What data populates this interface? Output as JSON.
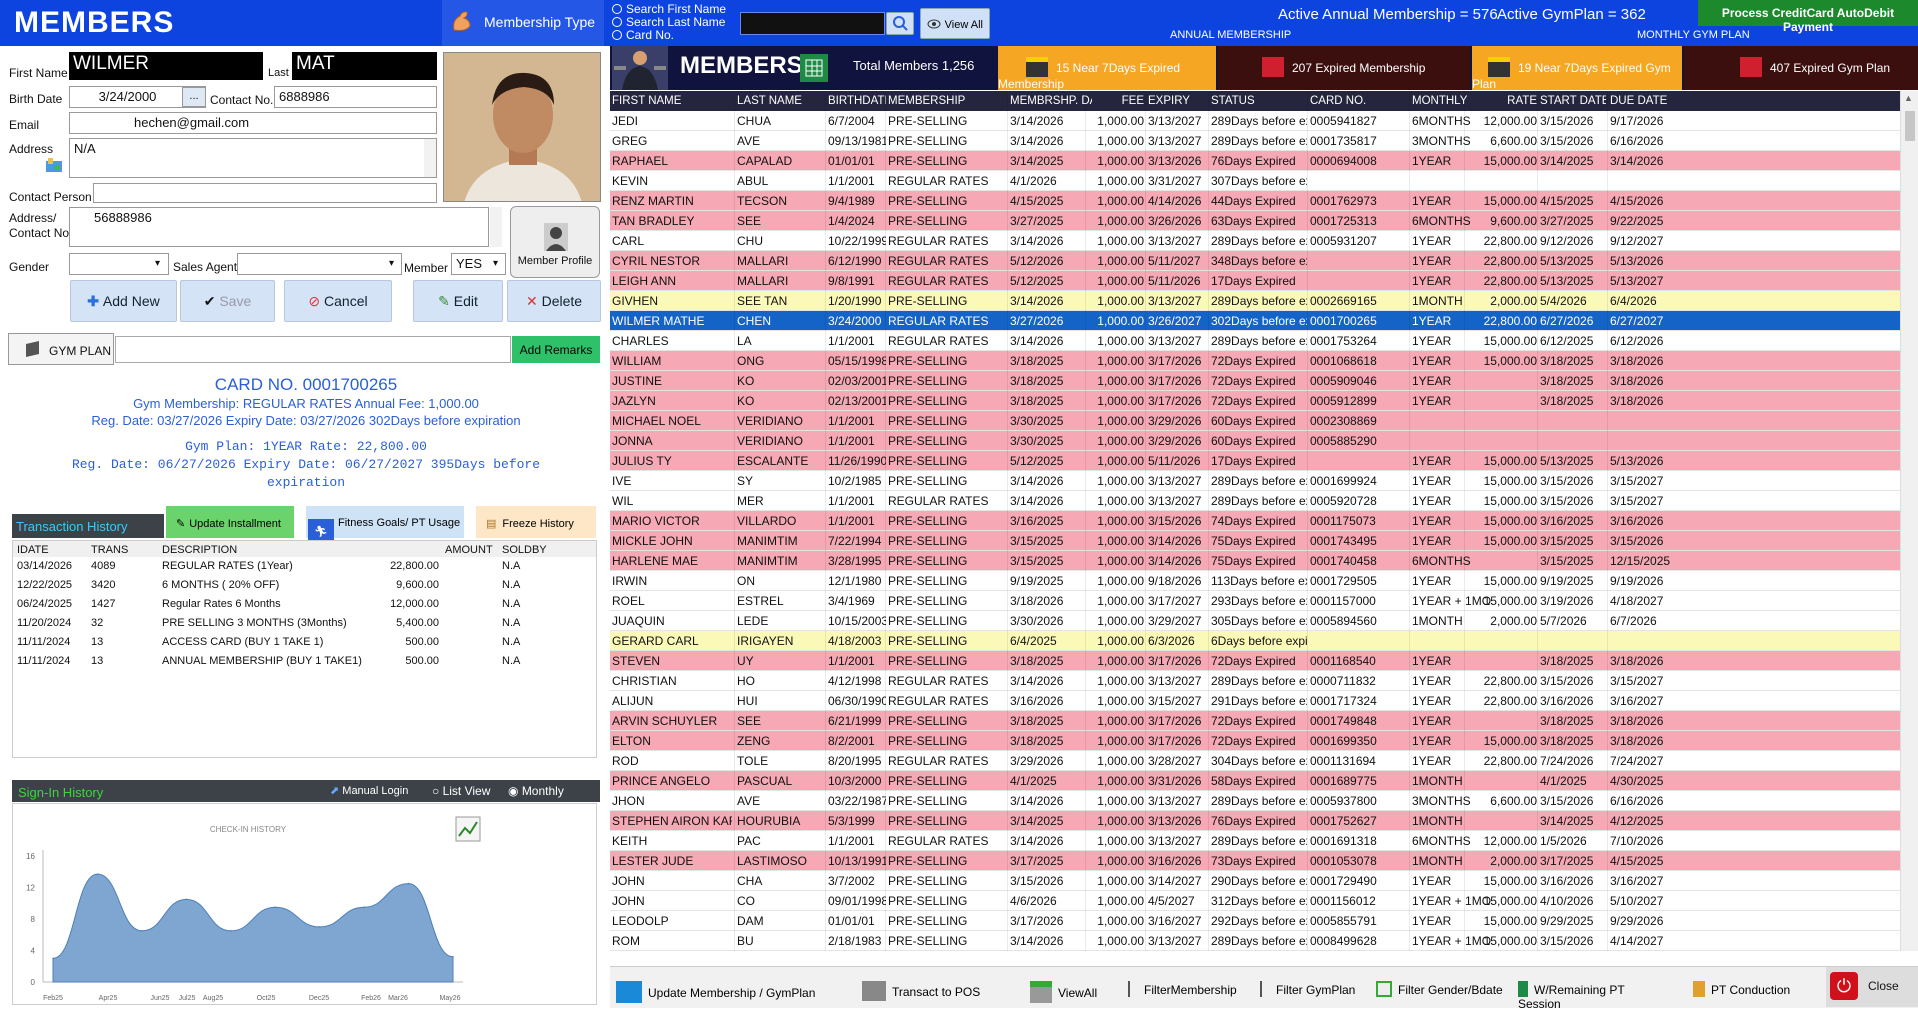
{
  "app": {
    "title": "MEMBERS"
  },
  "topbar": {
    "membership_type_label": "Membership Type",
    "search_options": [
      "Search First Name",
      "Search Last Name",
      "Card No."
    ],
    "search_value": "",
    "view_all_label": "View All",
    "annual_count": "Active Annual Membership = 576",
    "gym_count": "Active GymPlan = 362",
    "annual_label": "ANNUAL MEMBERSHIP",
    "monthly_label": "MONTHLY GYM PLAN",
    "cc_button": "Process CreditCard AutoDebit Payment"
  },
  "form": {
    "first_name_label": "First Name",
    "first_name": "WILMER",
    "last_label": "Last",
    "last_name": "MAT",
    "birth_label": "Birth Date",
    "birth_date": "3/24/2000",
    "date_btn": "...",
    "contact_label": "Contact No.",
    "contact": "6888986",
    "email_label": "Email",
    "email": "hechen@gmail.com",
    "address_label": "Address",
    "address": "N/A",
    "contact_person_label": "Contact Person",
    "contact_person": "",
    "address_contact_label1": "Address/",
    "address_contact_label2": "Contact No",
    "address_contact": "56888986",
    "gender_label": "Gender",
    "gender": "",
    "sales_agent_label": "Sales Agent",
    "sales_agent": "",
    "member_label": "Member",
    "member": "YES",
    "member_profile_label": "Member Profile"
  },
  "actions": {
    "add_new": "Add New",
    "save": "Save",
    "cancel": "Cancel",
    "edit": "Edit",
    "delete": "Delete"
  },
  "gymplan": {
    "tab": "GYM PLAN",
    "remarks": "",
    "add_remarks": "Add Remarks"
  },
  "card": {
    "card_no": "CARD NO.   0001700265",
    "line1": "Gym Membership: REGULAR RATES   Annual Fee: 1,000.00",
    "line2": "Reg. Date: 03/27/2026  Expiry Date: 03/27/2026   302Days before expiration",
    "line3": "Gym Plan: 1YEAR   Rate: 22,800.00",
    "line4": "Reg. Date: 06/27/2026  Expiry Date: 06/27/2027   395Days before",
    "line5": "expiration"
  },
  "transactions": {
    "title": "Transaction History",
    "update_installment": "Update Installment",
    "fitness_goals": "Fitness Goals/ PT Usage",
    "freeze_history": "Freeze History",
    "headers": [
      "IDATE",
      "TRANS",
      "DESCRIPTION",
      "AMOUNT",
      "SOLDBY"
    ],
    "rows": [
      [
        "03/14/2026",
        "4089",
        "REGULAR RATES (1Year)",
        "22,800.00",
        "N.A"
      ],
      [
        "12/22/2025",
        "3420",
        "6 MONTHS ( 20% OFF)",
        "9,600.00",
        "N.A"
      ],
      [
        "06/24/2025",
        "1427",
        "Regular Rates 6 Months",
        "12,000.00",
        "N.A"
      ],
      [
        "11/20/2024",
        "32",
        "PRE SELLING  3 MONTHS (3Months)",
        "5,400.00",
        "N.A"
      ],
      [
        "11/11/2024",
        "13",
        "ACCESS CARD (BUY 1 TAKE 1)",
        "500.00",
        "N.A"
      ],
      [
        "11/11/2024",
        "13",
        "ANNUAL MEMBERSHIP (BUY 1 TAKE1)",
        "500.00",
        "N.A"
      ]
    ]
  },
  "signin": {
    "title": "Sign-In History",
    "manual_login": "Manual Login",
    "list_view": "List View",
    "monthly": "Monthly",
    "chart_title": "CHECK-IN HISTORY"
  },
  "chart_data": {
    "type": "area",
    "title": "CHECK-IN HISTORY",
    "x": [
      "Feb25",
      "Apr25",
      "Jun25",
      "Jul25",
      "Aug25",
      "Oct25",
      "Dec25",
      "Feb26",
      "Mar26",
      "May26"
    ],
    "series": [
      {
        "values": [
          3,
          13.7,
          6.5,
          10.5,
          6.5,
          9.5,
          7,
          9.5,
          12.5,
          3.2
        ]
      }
    ],
    "yticks": [
      0,
      2,
      4,
      6,
      8,
      10,
      12,
      14,
      16
    ],
    "ylim": [
      0,
      16
    ],
    "yticks_shown": [
      "0",
      "2",
      "4",
      "6",
      "8",
      "10",
      "12",
      "14",
      "16"
    ],
    "color": "#7ea6d1"
  },
  "members_header": {
    "title": "MEMBERS",
    "total": "Total Members 1,256",
    "near_expired_membership": "15 Near 7Days Expired Membership",
    "expired_membership": "207 Expired Membership",
    "near_expired_gym": "19 Near 7Days Expired Gym Plan",
    "expired_gym": "407 Expired Gym Plan"
  },
  "grid": {
    "headers": [
      "FIRST NAME",
      "LAST NAME",
      "BIRTHDATE",
      "MEMBERSHIP",
      "MEMBRSHP. DATE",
      "FEE",
      "EXPIRY",
      "STATUS",
      "CARD NO.",
      "MONTHLY",
      "RATE",
      "START DATE",
      "DUE DATE"
    ],
    "rows": [
      {
        "c": [
          "JEDI",
          "CHUA",
          "6/7/2004",
          "PRE-SELLING",
          "3/14/2026",
          "1,000.00",
          "3/13/2027",
          "289Days before exp",
          "0005941827",
          "6MONTHS",
          "12,000.00",
          "3/15/2026",
          "9/17/2026"
        ],
        "s": ""
      },
      {
        "c": [
          "GREG",
          "AVE",
          "09/13/1981",
          "PRE-SELLING",
          "3/14/2026",
          "1,000.00",
          "3/13/2027",
          "289Days before exp",
          "0001735817",
          "3MONTHS",
          "6,600.00",
          "3/15/2026",
          "6/16/2026"
        ],
        "s": ""
      },
      {
        "c": [
          "RAPHAEL",
          "CAPALAD",
          "01/01/01",
          "PRE-SELLING",
          "3/14/2025",
          "1,000.00",
          "3/13/2026",
          "76Days Expired",
          "0000694008",
          "1YEAR",
          "15,000.00",
          "3/14/2025",
          "3/14/2026"
        ],
        "s": "pink"
      },
      {
        "c": [
          "KEVIN",
          "ABUL",
          "1/1/2001",
          "REGULAR RATES",
          "4/1/2026",
          "1,000.00",
          "3/31/2027",
          "307Days before exp",
          "",
          "",
          "",
          "",
          ""
        ],
        "s": ""
      },
      {
        "c": [
          "RENZ MARTIN",
          "TECSON",
          "9/4/1989",
          "PRE-SELLING",
          "4/15/2025",
          "1,000.00",
          "4/14/2026",
          "44Days Expired",
          "0001762973",
          "1YEAR",
          "15,000.00",
          "4/15/2025",
          "4/15/2026"
        ],
        "s": "pink"
      },
      {
        "c": [
          "TAN BRADLEY",
          "SEE",
          "1/4/2024",
          "PRE-SELLING",
          "3/27/2025",
          "1,000.00",
          "3/26/2026",
          "63Days Expired",
          "0001725313",
          "6MONTHS",
          "9,600.00",
          "3/27/2025",
          "9/22/2025"
        ],
        "s": "pink"
      },
      {
        "c": [
          "CARL",
          "CHU",
          "10/22/1999",
          "REGULAR RATES",
          "3/14/2026",
          "1,000.00",
          "3/13/2027",
          "289Days before exp",
          "0005931207",
          "1YEAR",
          "22,800.00",
          "9/12/2026",
          "9/12/2027"
        ],
        "s": ""
      },
      {
        "c": [
          "CYRIL NESTOR",
          "MALLARI",
          "6/12/1990",
          "REGULAR RATES",
          "5/12/2026",
          "1,000.00",
          "5/11/2027",
          "348Days before exp",
          "",
          "1YEAR",
          "22,800.00",
          "5/13/2025",
          "5/13/2026"
        ],
        "s": "pink"
      },
      {
        "c": [
          "LEIGH ANN",
          "MALLARI",
          "9/8/1991",
          "REGULAR RATES",
          "5/12/2025",
          "1,000.00",
          "5/11/2026",
          "17Days Expired",
          "",
          "1YEAR",
          "22,800.00",
          "5/13/2025",
          "5/13/2027"
        ],
        "s": "pink"
      },
      {
        "c": [
          "GIVHEN",
          "SEE TAN",
          "1/20/1990",
          "PRE-SELLING",
          "3/14/2026",
          "1,000.00",
          "3/13/2027",
          "289Days before exp",
          "0002669165",
          "1MONTH",
          "2,000.00",
          "5/4/2026",
          "6/4/2026"
        ],
        "s": "yellow"
      },
      {
        "c": [
          "WILMER MATHE",
          "CHEN",
          "3/24/2000",
          "REGULAR RATES",
          "3/27/2026",
          "1,000.00",
          "3/26/2027",
          "302Days before exp",
          "0001700265",
          "1YEAR",
          "22,800.00",
          "6/27/2026",
          "6/27/2027"
        ],
        "s": "sel"
      },
      {
        "c": [
          "CHARLES",
          "LA",
          "1/1/2001",
          "REGULAR RATES",
          "3/14/2026",
          "1,000.00",
          "3/13/2027",
          "289Days before exp",
          "0001753264",
          "1YEAR",
          "15,000.00",
          "6/12/2025",
          "6/12/2026"
        ],
        "s": ""
      },
      {
        "c": [
          "WILLIAM",
          "ONG",
          "05/15/1998",
          "PRE-SELLING",
          "3/18/2025",
          "1,000.00",
          "3/17/2026",
          "72Days Expired",
          "0001068618",
          "1YEAR",
          "15,000.00",
          "3/18/2025",
          "3/18/2026"
        ],
        "s": "pink"
      },
      {
        "c": [
          "JUSTINE",
          "KO",
          "02/03/2001",
          "PRE-SELLING",
          "3/18/2025",
          "1,000.00",
          "3/17/2026",
          "72Days Expired",
          "0005909046",
          "1YEAR",
          "",
          "3/18/2025",
          "3/18/2026"
        ],
        "s": "pink"
      },
      {
        "c": [
          "JAZLYN",
          "KO",
          "02/13/2001",
          "PRE-SELLING",
          "3/18/2025",
          "1,000.00",
          "3/17/2026",
          "72Days Expired",
          "0005912899",
          "1YEAR",
          "",
          "3/18/2025",
          "3/18/2026"
        ],
        "s": "pink"
      },
      {
        "c": [
          "MICHAEL NOEL",
          "VERIDIANO",
          "1/1/2001",
          "PRE-SELLING",
          "3/30/2025",
          "1,000.00",
          "3/29/2026",
          "60Days Expired",
          "0002308869",
          "",
          "",
          "",
          ""
        ],
        "s": "pink"
      },
      {
        "c": [
          "JONNA",
          "VERIDIANO",
          "1/1/2001",
          "PRE-SELLING",
          "3/30/2025",
          "1,000.00",
          "3/29/2026",
          "60Days Expired",
          "0005885290",
          "",
          "",
          "",
          ""
        ],
        "s": "pink"
      },
      {
        "c": [
          "JULIUS TY",
          "ESCALANTE",
          "11/26/1990",
          "PRE-SELLING",
          "5/12/2025",
          "1,000.00",
          "5/11/2026",
          "17Days Expired",
          "",
          "1YEAR",
          "15,000.00",
          "5/13/2025",
          "5/13/2026"
        ],
        "s": "pink"
      },
      {
        "c": [
          "IVE",
          "SY",
          "10/2/1985",
          "PRE-SELLING",
          "3/14/2026",
          "1,000.00",
          "3/13/2027",
          "289Days before exp",
          "0001699924",
          "1YEAR",
          "15,000.00",
          "3/15/2026",
          "3/15/2027"
        ],
        "s": ""
      },
      {
        "c": [
          "WIL",
          "MER",
          "1/1/2001",
          "REGULAR RATES",
          "3/14/2026",
          "1,000.00",
          "3/13/2027",
          "289Days before exp",
          "0005920728",
          "1YEAR",
          "15,000.00",
          "3/15/2026",
          "3/15/2027"
        ],
        "s": ""
      },
      {
        "c": [
          "MARIO VICTOR",
          "VILLARDO",
          "1/1/2001",
          "PRE-SELLING",
          "3/16/2025",
          "1,000.00",
          "3/15/2026",
          "74Days Expired",
          "0001175073",
          "1YEAR",
          "15,000.00",
          "3/16/2025",
          "3/16/2026"
        ],
        "s": "pink"
      },
      {
        "c": [
          "MICKLE JOHN",
          "MANIMTIM",
          "7/22/1994",
          "PRE-SELLING",
          "3/15/2025",
          "1,000.00",
          "3/14/2026",
          "75Days Expired",
          "0001743495",
          "1YEAR",
          "15,000.00",
          "3/15/2025",
          "3/15/2026"
        ],
        "s": "pink"
      },
      {
        "c": [
          "HARLENE MAE",
          "MANIMTIM",
          "3/28/1995",
          "PRE-SELLING",
          "3/15/2025",
          "1,000.00",
          "3/14/2026",
          "75Days Expired",
          "0001740458",
          "6MONTHS",
          "",
          "3/15/2025",
          "12/15/2025"
        ],
        "s": "pink"
      },
      {
        "c": [
          "IRWIN",
          "ON",
          "12/1/1980",
          "PRE-SELLING",
          "9/19/2025",
          "1,000.00",
          "9/18/2026",
          "113Days before exp",
          "0001729505",
          "1YEAR",
          "15,000.00",
          "9/19/2025",
          "9/19/2026"
        ],
        "s": ""
      },
      {
        "c": [
          "ROEL",
          "ESTREL",
          "3/4/1969",
          "PRE-SELLING",
          "3/18/2026",
          "1,000.00",
          "3/17/2027",
          "293Days before exp",
          "0001157000",
          "1YEAR + 1MONT",
          "15,000.00",
          "3/19/2026",
          "4/18/2027"
        ],
        "s": ""
      },
      {
        "c": [
          "JUAQUIN",
          "LEDE",
          "10/15/2003",
          "PRE-SELLING",
          "3/30/2026",
          "1,000.00",
          "3/29/2027",
          "305Days before exp",
          "0005894560",
          "1MONTH",
          "2,000.00",
          "5/7/2026",
          "6/7/2026"
        ],
        "s": ""
      },
      {
        "c": [
          "GERARD CARL",
          "IRIGAYEN",
          "4/18/2003",
          "PRE-SELLING",
          "6/4/2025",
          "1,000.00",
          "6/3/2026",
          "6Days before expira",
          "",
          "",
          "",
          "",
          ""
        ],
        "s": "yellow"
      },
      {
        "c": [
          "STEVEN",
          "UY",
          "1/1/2001",
          "PRE-SELLING",
          "3/18/2025",
          "1,000.00",
          "3/17/2026",
          "72Days Expired",
          "0001168540",
          "1YEAR",
          "",
          "3/18/2025",
          "3/18/2026"
        ],
        "s": "pink"
      },
      {
        "c": [
          "CHRISTIAN",
          "HO",
          "4/12/1998",
          "REGULAR RATES",
          "3/14/2026",
          "1,000.00",
          "3/13/2027",
          "289Days before exp",
          "0000711832",
          "1YEAR",
          "22,800.00",
          "3/15/2026",
          "3/15/2027"
        ],
        "s": ""
      },
      {
        "c": [
          "ALIJUN",
          "HUI",
          "06/30/1990",
          "REGULAR RATES",
          "3/16/2026",
          "1,000.00",
          "3/15/2027",
          "291Days before exp",
          "0001717324",
          "1YEAR",
          "22,800.00",
          "3/16/2026",
          "3/16/2027"
        ],
        "s": ""
      },
      {
        "c": [
          "ARVIN SCHUYLER",
          "SEE",
          "6/21/1999",
          "PRE-SELLING",
          "3/18/2025",
          "1,000.00",
          "3/17/2026",
          "72Days Expired",
          "0001749848",
          "1YEAR",
          "",
          "3/18/2025",
          "3/18/2026"
        ],
        "s": "pink"
      },
      {
        "c": [
          "ELTON",
          "ZENG",
          "8/2/2001",
          "PRE-SELLING",
          "3/18/2025",
          "1,000.00",
          "3/17/2026",
          "72Days Expired",
          "0001699350",
          "1YEAR",
          "15,000.00",
          "3/18/2025",
          "3/18/2026"
        ],
        "s": "pink"
      },
      {
        "c": [
          "ROD",
          "TOLE",
          "8/20/1995",
          "REGULAR RATES",
          "3/29/2026",
          "1,000.00",
          "3/28/2027",
          "304Days before exp",
          "0001131694",
          "1YEAR",
          "22,800.00",
          "7/24/2026",
          "7/24/2027"
        ],
        "s": ""
      },
      {
        "c": [
          "PRINCE ANGELO",
          "PASCUAL",
          "10/3/2000",
          "PRE-SELLING",
          "4/1/2025",
          "1,000.00",
          "3/31/2026",
          "58Days Expired",
          "0001689775",
          "1MONTH",
          "",
          "4/1/2025",
          "4/30/2025"
        ],
        "s": "pink"
      },
      {
        "c": [
          "JHON",
          "AVE",
          "03/22/1987",
          "PRE-SELLING",
          "3/14/2026",
          "1,000.00",
          "3/13/2027",
          "289Days before exp",
          "0005937800",
          "3MONTHS",
          "6,600.00",
          "3/15/2026",
          "6/16/2026"
        ],
        "s": ""
      },
      {
        "c": [
          "STEPHEN AIRON KARL",
          "HOURUBIA",
          "5/3/1999",
          "PRE-SELLING",
          "3/14/2025",
          "1,000.00",
          "3/13/2026",
          "76Days Expired",
          "0001752627",
          "1MONTH",
          "",
          "3/14/2025",
          "4/12/2025"
        ],
        "s": "pink"
      },
      {
        "c": [
          "KEITH",
          "PAC",
          "1/1/2001",
          "REGULAR RATES",
          "3/14/2026",
          "1,000.00",
          "3/13/2027",
          "289Days before exp",
          "0001691318",
          "6MONTHS",
          "12,000.00",
          "1/5/2026",
          "7/10/2026"
        ],
        "s": ""
      },
      {
        "c": [
          "LESTER JUDE",
          "LASTIMOSO",
          "10/13/1991",
          "PRE-SELLING",
          "3/17/2025",
          "1,000.00",
          "3/16/2026",
          "73Days Expired",
          "0001053078",
          "1MONTH",
          "2,000.00",
          "3/17/2025",
          "4/15/2025"
        ],
        "s": "pink"
      },
      {
        "c": [
          "JOHN",
          "CHA",
          "3/7/2002",
          "PRE-SELLING",
          "3/15/2026",
          "1,000.00",
          "3/14/2027",
          "290Days before exp",
          "0001729490",
          "1YEAR",
          "15,000.00",
          "3/16/2026",
          "3/16/2027"
        ],
        "s": ""
      },
      {
        "c": [
          "JOHN",
          "CO",
          "09/01/1998",
          "PRE-SELLING",
          "4/6/2026",
          "1,000.00",
          "4/5/2027",
          "312Days before exp",
          "0001156012",
          "1YEAR + 1MONT",
          "15,000.00",
          "4/10/2026",
          "5/10/2027"
        ],
        "s": ""
      },
      {
        "c": [
          "LEODOLP",
          "DAM",
          "01/01/01",
          "PRE-SELLING",
          "3/17/2026",
          "1,000.00",
          "3/16/2027",
          "292Days before exp",
          "0005855791",
          "1YEAR",
          "15,000.00",
          "9/29/2025",
          "9/29/2026"
        ],
        "s": ""
      },
      {
        "c": [
          "ROM",
          "BU",
          "2/18/1983",
          "PRE-SELLING",
          "3/14/2026",
          "1,000.00",
          "3/13/2027",
          "289Days before exp",
          "0008499628",
          "1YEAR + 1MONT",
          "15,000.00",
          "3/15/2026",
          "4/14/2027"
        ],
        "s": ""
      }
    ]
  },
  "bottom": {
    "update": "Update Membership / GymPlan",
    "pos": "Transact to POS",
    "viewall": "ViewAll",
    "filter_membership": "FilterMembership",
    "filter_gym": "Filter GymPlan",
    "filter_gender": "Filter Gender/Bdate",
    "pt_session": "W/Remaining PT Session",
    "pt_conduction": "PT Conduction",
    "close": "Close"
  }
}
